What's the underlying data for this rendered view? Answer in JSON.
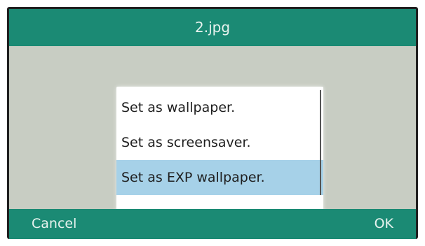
{
  "title": "2.jpg",
  "menu": {
    "items": [
      {
        "label": "Set as wallpaper."
      },
      {
        "label": "Set as screensaver."
      },
      {
        "label": "Set as EXP wallpaper.",
        "selected": true
      }
    ]
  },
  "softkeys": {
    "left": "Cancel",
    "right": "OK"
  },
  "colors": {
    "bar": "#1b8a74",
    "background": "#c8cdc3",
    "selection": "#a6d1e8"
  }
}
